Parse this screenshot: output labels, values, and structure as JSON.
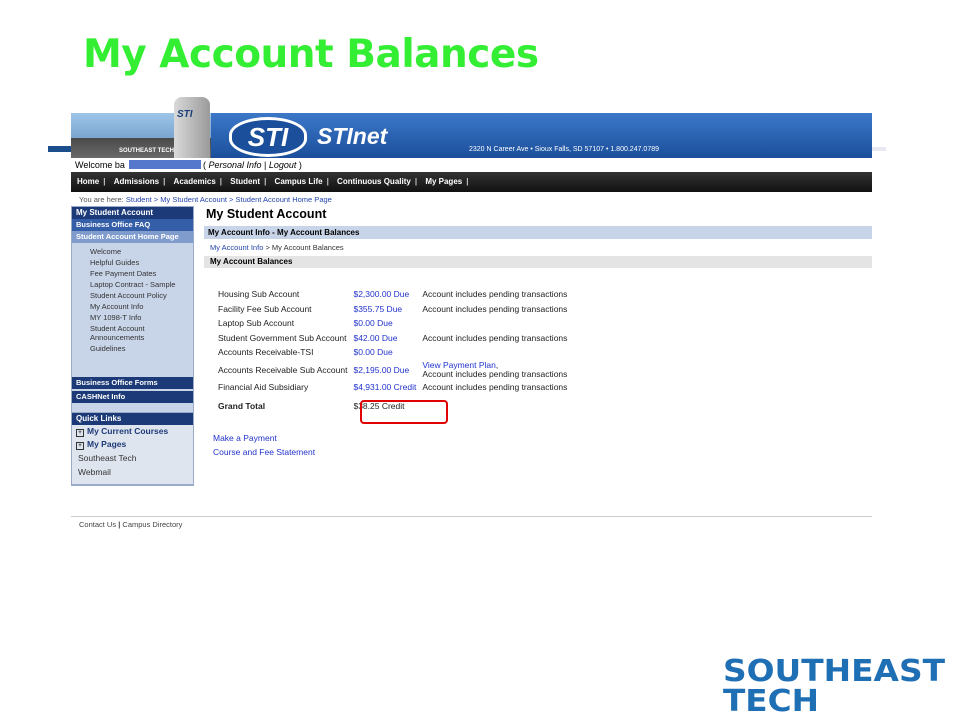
{
  "slide": {
    "title": "My Account Balances"
  },
  "header": {
    "photo_caption": "SOUTHEAST TECH",
    "tower_label": "STI",
    "logo": "STI",
    "brand": "STInet",
    "address": "2320 N Career Ave • Sioux Falls, SD 57107 • 1.800.247.0789",
    "welcome": "Welcome ba",
    "personal_info": "Personal Info",
    "logout": "Logout"
  },
  "nav": {
    "items": [
      "Home",
      "Admissions",
      "Academics",
      "Student",
      "Campus Life",
      "Continuous Quality",
      "My Pages"
    ]
  },
  "breadcrumb": {
    "prefix": "You are here:",
    "trail": "Student > My Student Account > Student Account Home Page"
  },
  "sidebar": {
    "head": "My Student Account",
    "faq": "Business Office FAQ",
    "active": "Student Account Home Page",
    "items": [
      "Welcome",
      "Helpful Guides",
      "Fee Payment Dates",
      "Laptop Contract - Sample",
      "Student Account Policy",
      "My Account Info",
      "MY 1098-T Info",
      "Student Account Announcements",
      "Guidelines"
    ],
    "forms": "Business Office Forms",
    "cashnet": "CASHNet Info"
  },
  "quick_links": {
    "head": "Quick Links",
    "courses": "My Current Courses",
    "pages": "My Pages",
    "southeast": "Southeast Tech",
    "webmail": "Webmail"
  },
  "main": {
    "title": "My Student Account",
    "section": "My Account Info - My Account Balances",
    "subcrumb_link": "My Account Info",
    "subcrumb_current": "> My Account Balances",
    "balances_header": "My Account Balances",
    "rows": [
      {
        "name": "Housing Sub Account",
        "amount": "$2,300.00 Due",
        "note": "Account includes pending transactions"
      },
      {
        "name": "Facility Fee Sub Account",
        "amount": "$355.75 Due",
        "note": "Account includes pending transactions"
      },
      {
        "name": "Laptop Sub Account",
        "amount": "$0.00 Due",
        "note": ""
      },
      {
        "name": "Student Government Sub Account",
        "amount": "$42.00 Due",
        "note": "Account includes pending transactions"
      },
      {
        "name": "Accounts Receivable-TSI",
        "amount": "$0.00 Due",
        "note": ""
      },
      {
        "name": "Accounts Receivable Sub Account",
        "amount": "$2,195.00 Due",
        "note_link": "View Payment Plan",
        "note": "Account includes pending transactions"
      },
      {
        "name": "Financial Aid Subsidiary",
        "amount": "$4,931.00 Credit",
        "note": "Account includes pending transactions"
      }
    ],
    "grand_total_label": "Grand Total",
    "grand_total_value": "$38.25 Credit",
    "make_payment": "Make a Payment",
    "statement": "Course and Fee Statement"
  },
  "footer": {
    "contact": "Contact Us",
    "directory": "Campus Directory"
  },
  "branding": {
    "line1": "SOUTHEAST",
    "line2": "TECH",
    "color": "#1f6fb5"
  }
}
